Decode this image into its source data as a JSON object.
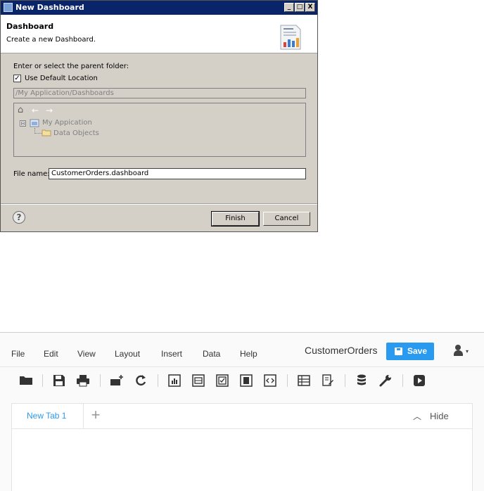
{
  "dialog": {
    "title": "New Dashboard",
    "window_buttons": {
      "minimize": "_",
      "maximize": "□",
      "close": "X"
    },
    "banner": {
      "heading": "Dashboard",
      "description": "Create a new Dashboard."
    },
    "parent_folder_label": "Enter or select the parent folder:",
    "use_default_location": {
      "label": "Use Default Location",
      "checked": true,
      "mark": "✓"
    },
    "location_path": "/My Application/Dashboards",
    "tree": {
      "toolbar": {
        "home": "⌂",
        "back": "←",
        "forward": "→"
      },
      "expander": "⊟",
      "root": "My Appication",
      "children": [
        "Data Objects"
      ]
    },
    "file_name_label": "File name:",
    "file_name_value": "CustomerOrders.dashboard",
    "help_glyph": "?",
    "buttons": {
      "finish": "Finish",
      "cancel": "Cancel"
    }
  },
  "app": {
    "menu": [
      "File",
      "Edit",
      "View",
      "Layout",
      "Insert",
      "Data",
      "Help"
    ],
    "document_title": "CustomerOrders",
    "save_label": "Save",
    "user_caret": "▾",
    "toolbar_icons": [
      "open-folder",
      "save",
      "print",
      "add-widget",
      "refresh",
      "chart-widget",
      "table-widget",
      "checkbox-widget",
      "filter-widget",
      "code-widget",
      "grid-view",
      "edit-doc",
      "database",
      "settings-wrench",
      "preview-play"
    ],
    "tabs": [
      {
        "label": "New Tab 1",
        "active": true
      }
    ],
    "add_tab_glyph": "+",
    "hide_label": "Hide",
    "hide_chevron": "︿",
    "accent_color": "#2a9af0"
  }
}
